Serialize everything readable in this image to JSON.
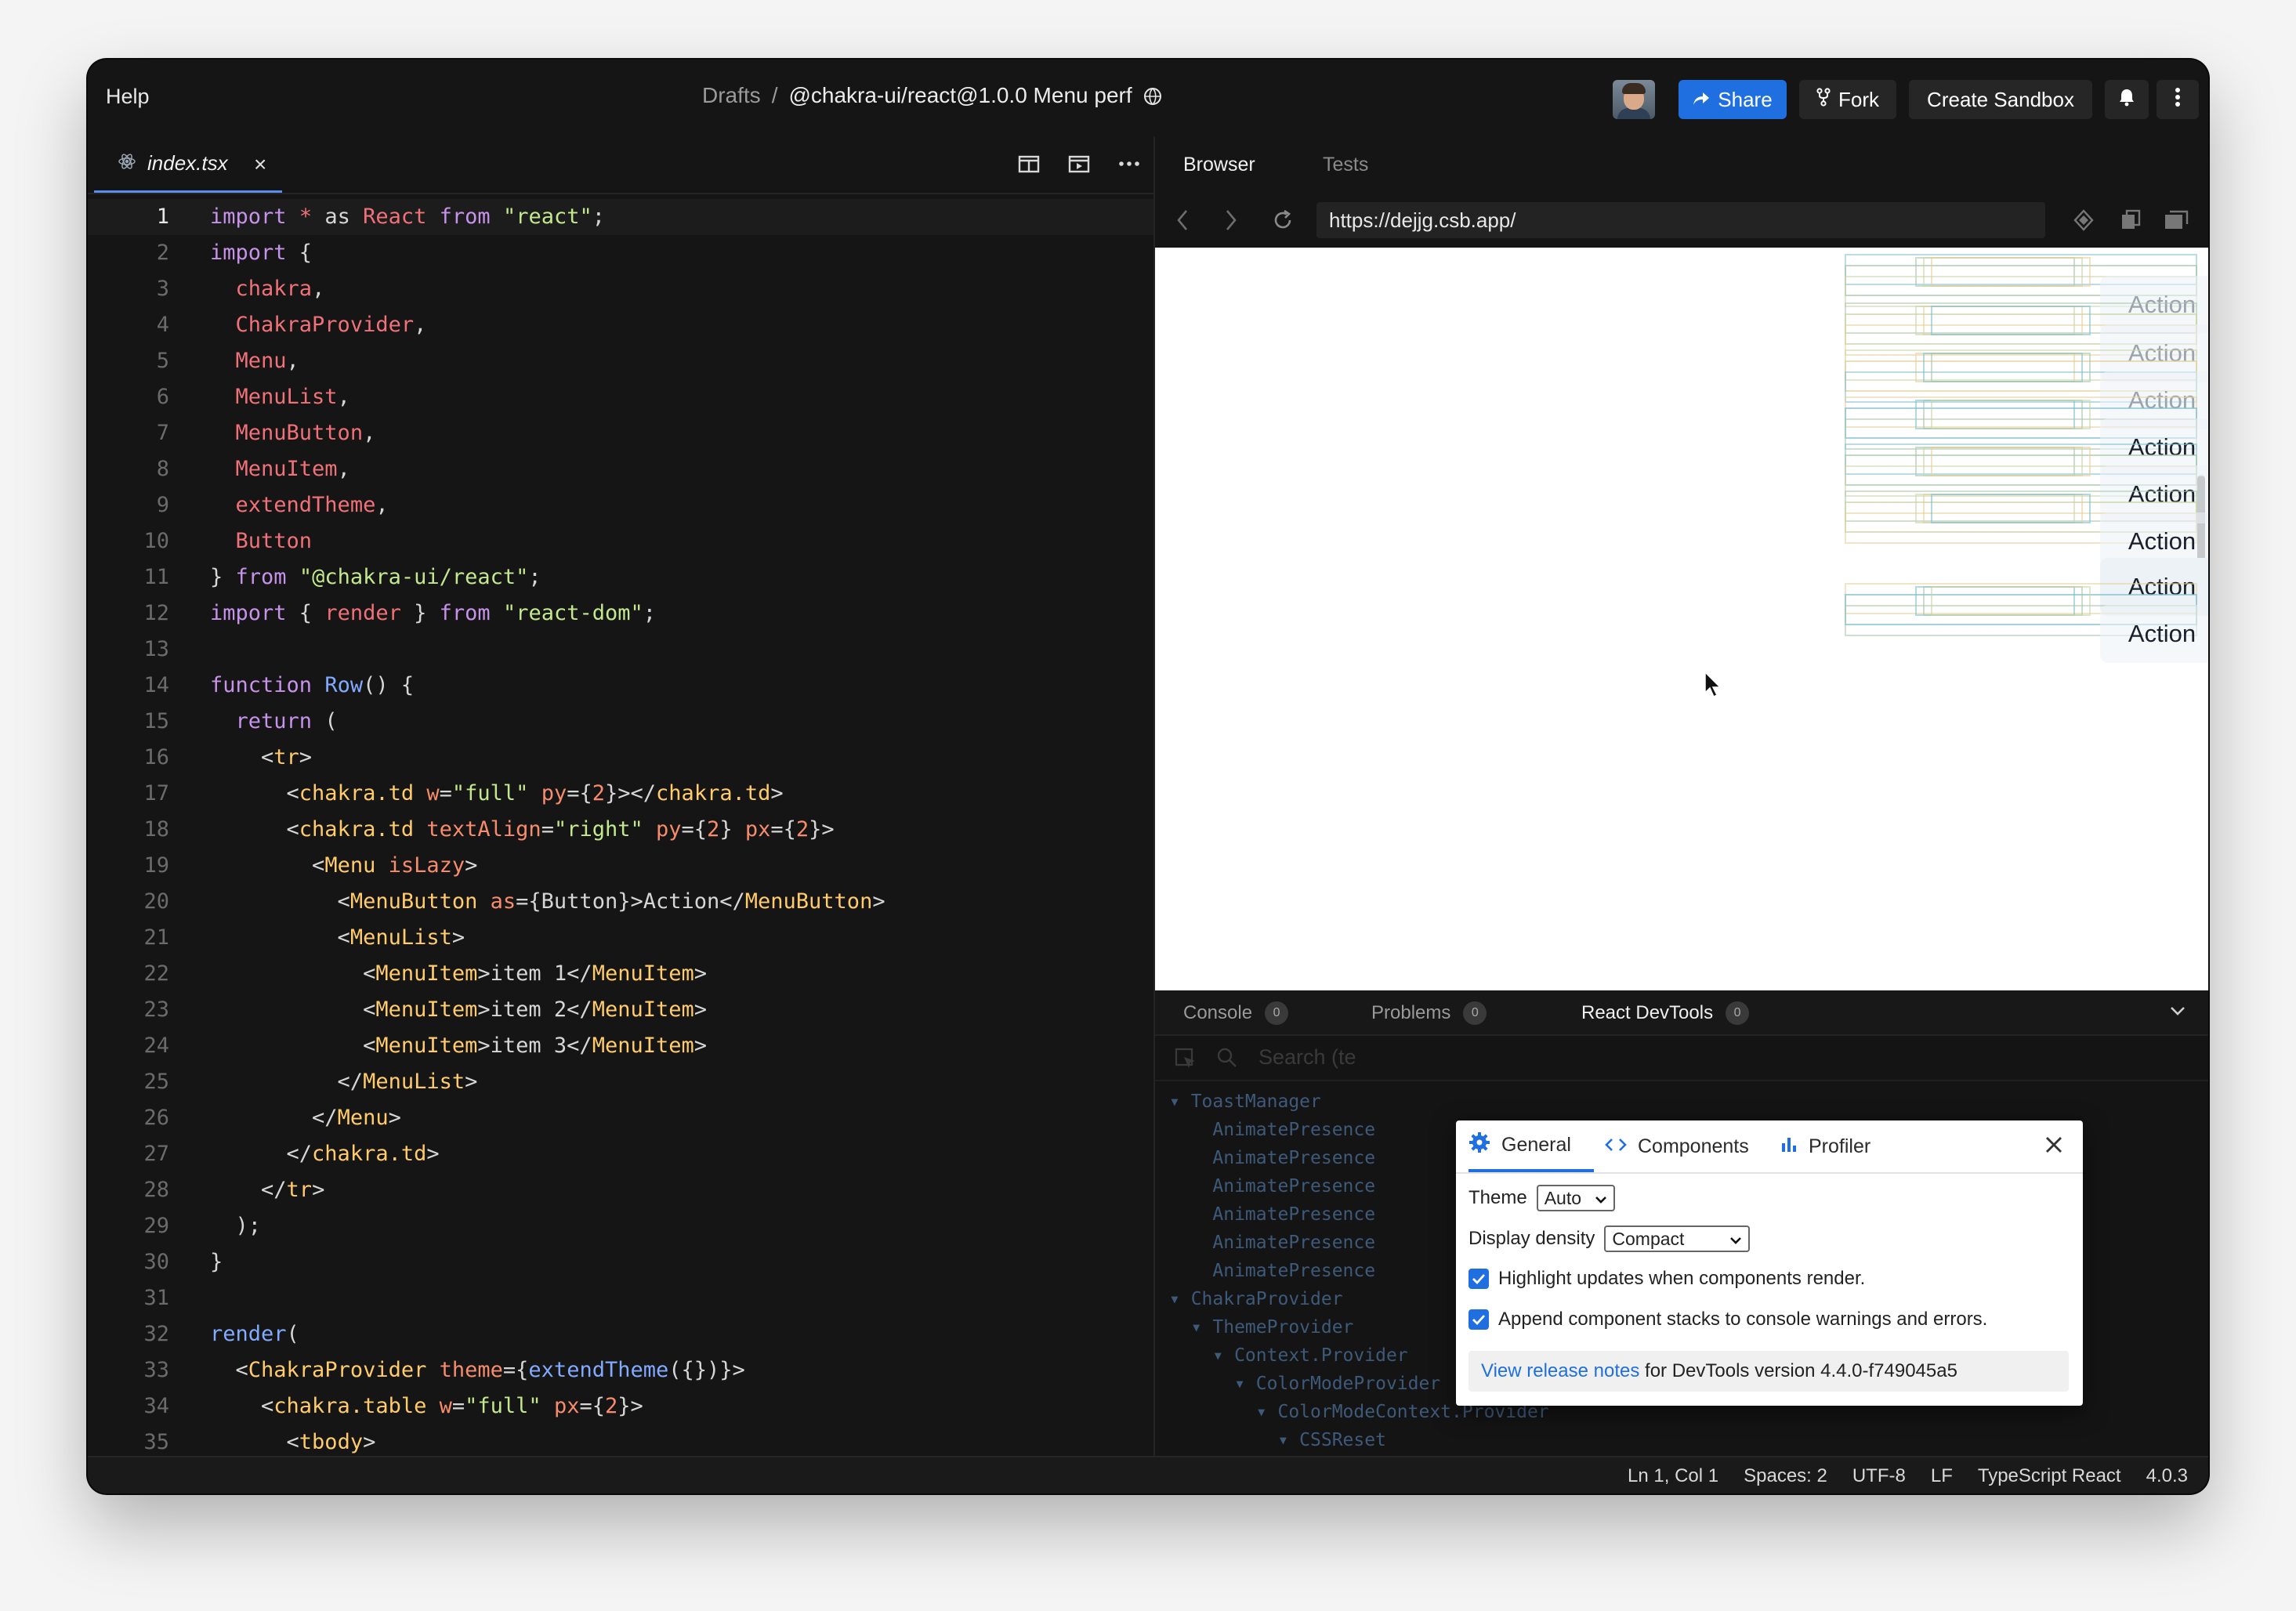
{
  "header": {
    "help": "Help",
    "breadcrumb_drafts": "Drafts",
    "breadcrumb_sep": "/",
    "sandbox_title": "@chakra-ui/react@1.0.0 Menu perf",
    "share": "Share",
    "fork": "Fork",
    "create_sandbox": "Create Sandbox"
  },
  "editor": {
    "tab_name": "index.tsx",
    "tab_close": "×",
    "active_line": 1,
    "lines": [
      [
        [
          "k",
          "import"
        ],
        [
          "p",
          " "
        ],
        [
          "i",
          "*"
        ],
        [
          "p",
          " as "
        ],
        [
          "i",
          "React"
        ],
        [
          "p",
          " "
        ],
        [
          "k",
          "from"
        ],
        [
          "p",
          " "
        ],
        [
          "s",
          "\"react\""
        ],
        [
          "p",
          ";"
        ]
      ],
      [
        [
          "k",
          "import"
        ],
        [
          "p",
          " {"
        ]
      ],
      [
        [
          "p",
          "  "
        ],
        [
          "i",
          "chakra"
        ],
        [
          "p",
          ","
        ]
      ],
      [
        [
          "p",
          "  "
        ],
        [
          "i",
          "ChakraProvider"
        ],
        [
          "p",
          ","
        ]
      ],
      [
        [
          "p",
          "  "
        ],
        [
          "i",
          "Menu"
        ],
        [
          "p",
          ","
        ]
      ],
      [
        [
          "p",
          "  "
        ],
        [
          "i",
          "MenuList"
        ],
        [
          "p",
          ","
        ]
      ],
      [
        [
          "p",
          "  "
        ],
        [
          "i",
          "MenuButton"
        ],
        [
          "p",
          ","
        ]
      ],
      [
        [
          "p",
          "  "
        ],
        [
          "i",
          "MenuItem"
        ],
        [
          "p",
          ","
        ]
      ],
      [
        [
          "p",
          "  "
        ],
        [
          "i",
          "extendTheme"
        ],
        [
          "p",
          ","
        ]
      ],
      [
        [
          "p",
          "  "
        ],
        [
          "i",
          "Button"
        ]
      ],
      [
        [
          "p",
          "} "
        ],
        [
          "k",
          "from"
        ],
        [
          "p",
          " "
        ],
        [
          "s",
          "\"@chakra-ui/react\""
        ],
        [
          "p",
          ";"
        ]
      ],
      [
        [
          "k",
          "import"
        ],
        [
          "p",
          " { "
        ],
        [
          "i",
          "render"
        ],
        [
          "p",
          " } "
        ],
        [
          "k",
          "from"
        ],
        [
          "p",
          " "
        ],
        [
          "s",
          "\"react-dom\""
        ],
        [
          "p",
          ";"
        ]
      ],
      [],
      [
        [
          "k",
          "function"
        ],
        [
          "p",
          " "
        ],
        [
          "f",
          "Row"
        ],
        [
          "p",
          "() {"
        ]
      ],
      [
        [
          "p",
          "  "
        ],
        [
          "k",
          "return"
        ],
        [
          "p",
          " ("
        ]
      ],
      [
        [
          "p",
          "    <"
        ],
        [
          "t",
          "tr"
        ],
        [
          "p",
          ">"
        ]
      ],
      [
        [
          "p",
          "      <"
        ],
        [
          "t",
          "chakra.td"
        ],
        [
          "p",
          " "
        ],
        [
          "a",
          "w"
        ],
        [
          "p",
          "="
        ],
        [
          "s",
          "\"full\""
        ],
        [
          "p",
          " "
        ],
        [
          "a",
          "py"
        ],
        [
          "p",
          "={"
        ],
        [
          "n",
          "2"
        ],
        [
          "p",
          "}></"
        ],
        [
          "t",
          "chakra.td"
        ],
        [
          "p",
          ">"
        ]
      ],
      [
        [
          "p",
          "      <"
        ],
        [
          "t",
          "chakra.td"
        ],
        [
          "p",
          " "
        ],
        [
          "a",
          "textAlign"
        ],
        [
          "p",
          "="
        ],
        [
          "s",
          "\"right\""
        ],
        [
          "p",
          " "
        ],
        [
          "a",
          "py"
        ],
        [
          "p",
          "={"
        ],
        [
          "n",
          "2"
        ],
        [
          "p",
          "} "
        ],
        [
          "a",
          "px"
        ],
        [
          "p",
          "={"
        ],
        [
          "n",
          "2"
        ],
        [
          "p",
          "}>"
        ]
      ],
      [
        [
          "p",
          "        <"
        ],
        [
          "t",
          "Menu"
        ],
        [
          "p",
          " "
        ],
        [
          "a",
          "isLazy"
        ],
        [
          "p",
          ">"
        ]
      ],
      [
        [
          "p",
          "          <"
        ],
        [
          "t",
          "MenuButton"
        ],
        [
          "p",
          " "
        ],
        [
          "a",
          "as"
        ],
        [
          "p",
          "={Button}>Action</"
        ],
        [
          "t",
          "MenuButton"
        ],
        [
          "p",
          ">"
        ]
      ],
      [
        [
          "p",
          "          <"
        ],
        [
          "t",
          "MenuList"
        ],
        [
          "p",
          ">"
        ]
      ],
      [
        [
          "p",
          "            <"
        ],
        [
          "t",
          "MenuItem"
        ],
        [
          "p",
          ">item 1</"
        ],
        [
          "t",
          "MenuItem"
        ],
        [
          "p",
          ">"
        ]
      ],
      [
        [
          "p",
          "            <"
        ],
        [
          "t",
          "MenuItem"
        ],
        [
          "p",
          ">item 2</"
        ],
        [
          "t",
          "MenuItem"
        ],
        [
          "p",
          ">"
        ]
      ],
      [
        [
          "p",
          "            <"
        ],
        [
          "t",
          "MenuItem"
        ],
        [
          "p",
          ">item 3</"
        ],
        [
          "t",
          "MenuItem"
        ],
        [
          "p",
          ">"
        ]
      ],
      [
        [
          "p",
          "          </"
        ],
        [
          "t",
          "MenuList"
        ],
        [
          "p",
          ">"
        ]
      ],
      [
        [
          "p",
          "        </"
        ],
        [
          "t",
          "Menu"
        ],
        [
          "p",
          ">"
        ]
      ],
      [
        [
          "p",
          "      </"
        ],
        [
          "t",
          "chakra.td"
        ],
        [
          "p",
          ">"
        ]
      ],
      [
        [
          "p",
          "    </"
        ],
        [
          "t",
          "tr"
        ],
        [
          "p",
          ">"
        ]
      ],
      [
        [
          "p",
          "  );"
        ]
      ],
      [
        [
          "p",
          "}"
        ]
      ],
      [],
      [
        [
          "f",
          "render"
        ],
        [
          "p",
          "("
        ]
      ],
      [
        [
          "p",
          "  <"
        ],
        [
          "t",
          "ChakraProvider"
        ],
        [
          "p",
          " "
        ],
        [
          "a",
          "theme"
        ],
        [
          "p",
          "={"
        ],
        [
          "f",
          "extendTheme"
        ],
        [
          "p",
          "({})}>"
        ]
      ],
      [
        [
          "p",
          "    <"
        ],
        [
          "t",
          "chakra.table"
        ],
        [
          "p",
          " "
        ],
        [
          "a",
          "w"
        ],
        [
          "p",
          "="
        ],
        [
          "s",
          "\"full\""
        ],
        [
          "p",
          " "
        ],
        [
          "a",
          "px"
        ],
        [
          "p",
          "={"
        ],
        [
          "n",
          "2"
        ],
        [
          "p",
          "}>"
        ]
      ],
      [
        [
          "p",
          "      <"
        ],
        [
          "t",
          "tbody"
        ],
        [
          "p",
          ">"
        ]
      ]
    ]
  },
  "preview": {
    "tab_browser": "Browser",
    "tab_tests": "Tests",
    "url": "https://dejjg.csb.app/",
    "action_label": "Action"
  },
  "bottom_panel": {
    "tabs": [
      {
        "label": "Console",
        "count": "0"
      },
      {
        "label": "Problems",
        "count": "0"
      },
      {
        "label": "React DevTools",
        "count": "0"
      }
    ],
    "search_placeholder": "Search (te",
    "tree": [
      "▾ ToastManager",
      "    AnimatePresence",
      "    AnimatePresence",
      "    AnimatePresence",
      "    AnimatePresence",
      "    AnimatePresence",
      "    AnimatePresence",
      "▾ ChakraProvider",
      "  ▾ ThemeProvider",
      "    ▾ Context.Provider",
      "      ▾ ColorModeProvider",
      "        ▾ ColorModeContext.Provider",
      "          ▾ CSSReset"
    ]
  },
  "devtools_settings": {
    "tab_general": "General",
    "tab_components": "Components",
    "tab_profiler": "Profiler",
    "theme_label": "Theme",
    "theme_value": "Auto",
    "density_label": "Display density",
    "density_value": "Compact",
    "highlight_updates": "Highlight updates when components render.",
    "append_stacks": "Append component stacks to console warnings and errors.",
    "release_link": "View release notes",
    "release_rest": " for DevTools version 4.4.0-f749045a5"
  },
  "status_bar": {
    "position": "Ln 1, Col 1",
    "spaces": "Spaces: 2",
    "encoding": "UTF-8",
    "eol": "LF",
    "language": "TypeScript React",
    "version": "4.0.3"
  },
  "colors": {
    "accent": "#1f6fe0",
    "keyword": "#c792ea",
    "string": "#c3e88d",
    "identifier": "#f07178",
    "function": "#82aaff",
    "tag": "#ffcb6b"
  }
}
